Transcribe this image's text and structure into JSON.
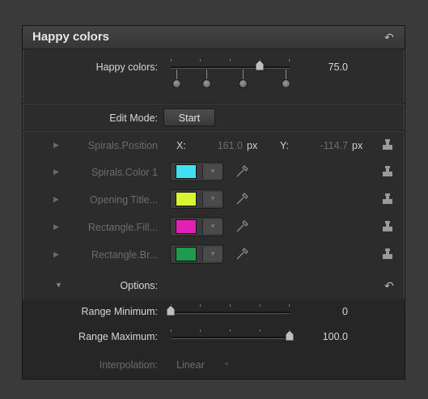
{
  "panel": {
    "title": "Happy colors",
    "reset_icon": "reset-arrow-icon"
  },
  "happy_colors": {
    "label": "Happy colors:",
    "value": "75.0",
    "slider_fraction": 0.75,
    "tag_count": 4
  },
  "edit_mode": {
    "label": "Edit Mode:",
    "button_label": "Start"
  },
  "params": [
    {
      "name": "Spirals.Position",
      "x_label": "X:",
      "x_value": "161.0",
      "x_unit": "px",
      "y_label": "Y:",
      "y_value": "-114.7",
      "y_unit": "px"
    },
    {
      "name": "Spirals.Color 1",
      "color": "#3fe0ef"
    },
    {
      "name": "Opening Title...",
      "color": "#d9f531"
    },
    {
      "name": "Rectangle.Fill...",
      "color": "#e41fb6"
    },
    {
      "name": "Rectangle.Br...",
      "color": "#1e9a4c"
    }
  ],
  "options": {
    "label": "Options:"
  },
  "range_min": {
    "label": "Range Minimum:",
    "value": "0",
    "slider_fraction": 0.0
  },
  "range_max": {
    "label": "Range Maximum:",
    "value": "100.0",
    "slider_fraction": 1.0
  },
  "interpolation": {
    "label": "Interpolation:",
    "value": "Linear",
    "stepper_glyph": "÷"
  }
}
